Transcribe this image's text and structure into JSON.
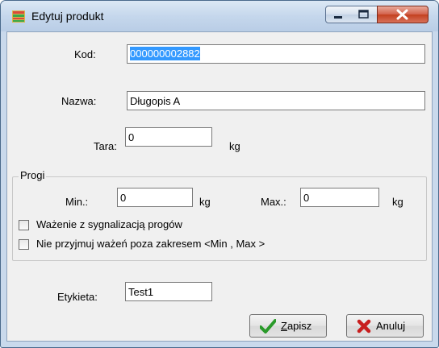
{
  "window": {
    "title": "Edytuj produkt",
    "icon": "app-icon",
    "controls": [
      "minimize-icon",
      "maximize-icon",
      "close-icon"
    ]
  },
  "form": {
    "kod_label": "Kod:",
    "kod_value": "000000002882",
    "nazwa_label": "Nazwa:",
    "nazwa_value": "Długopis A",
    "tara_label": "Tara:",
    "tara_value": "0",
    "tara_unit": "kg"
  },
  "progi": {
    "title": "Progi",
    "min_label": "Min.:",
    "min_value": "0",
    "min_unit": "kg",
    "max_label": "Max.:",
    "max_value": "0",
    "max_unit": "kg",
    "checkbox1_label": "Ważenie z sygnalizacją progów",
    "checkbox1_checked": false,
    "checkbox2_label": "Nie przyjmuj ważeń poza zakresem <Min , Max >",
    "checkbox2_checked": false
  },
  "etykieta": {
    "label": "Etykieta:",
    "value": "Test1"
  },
  "buttons": {
    "save_mnemonic": "Z",
    "save_rest": "apisz",
    "cancel_label": "Anuluj"
  },
  "colors": {
    "selection": "#3399ff",
    "save_icon": "#2a9a2a",
    "cancel_icon": "#c81e1e"
  }
}
